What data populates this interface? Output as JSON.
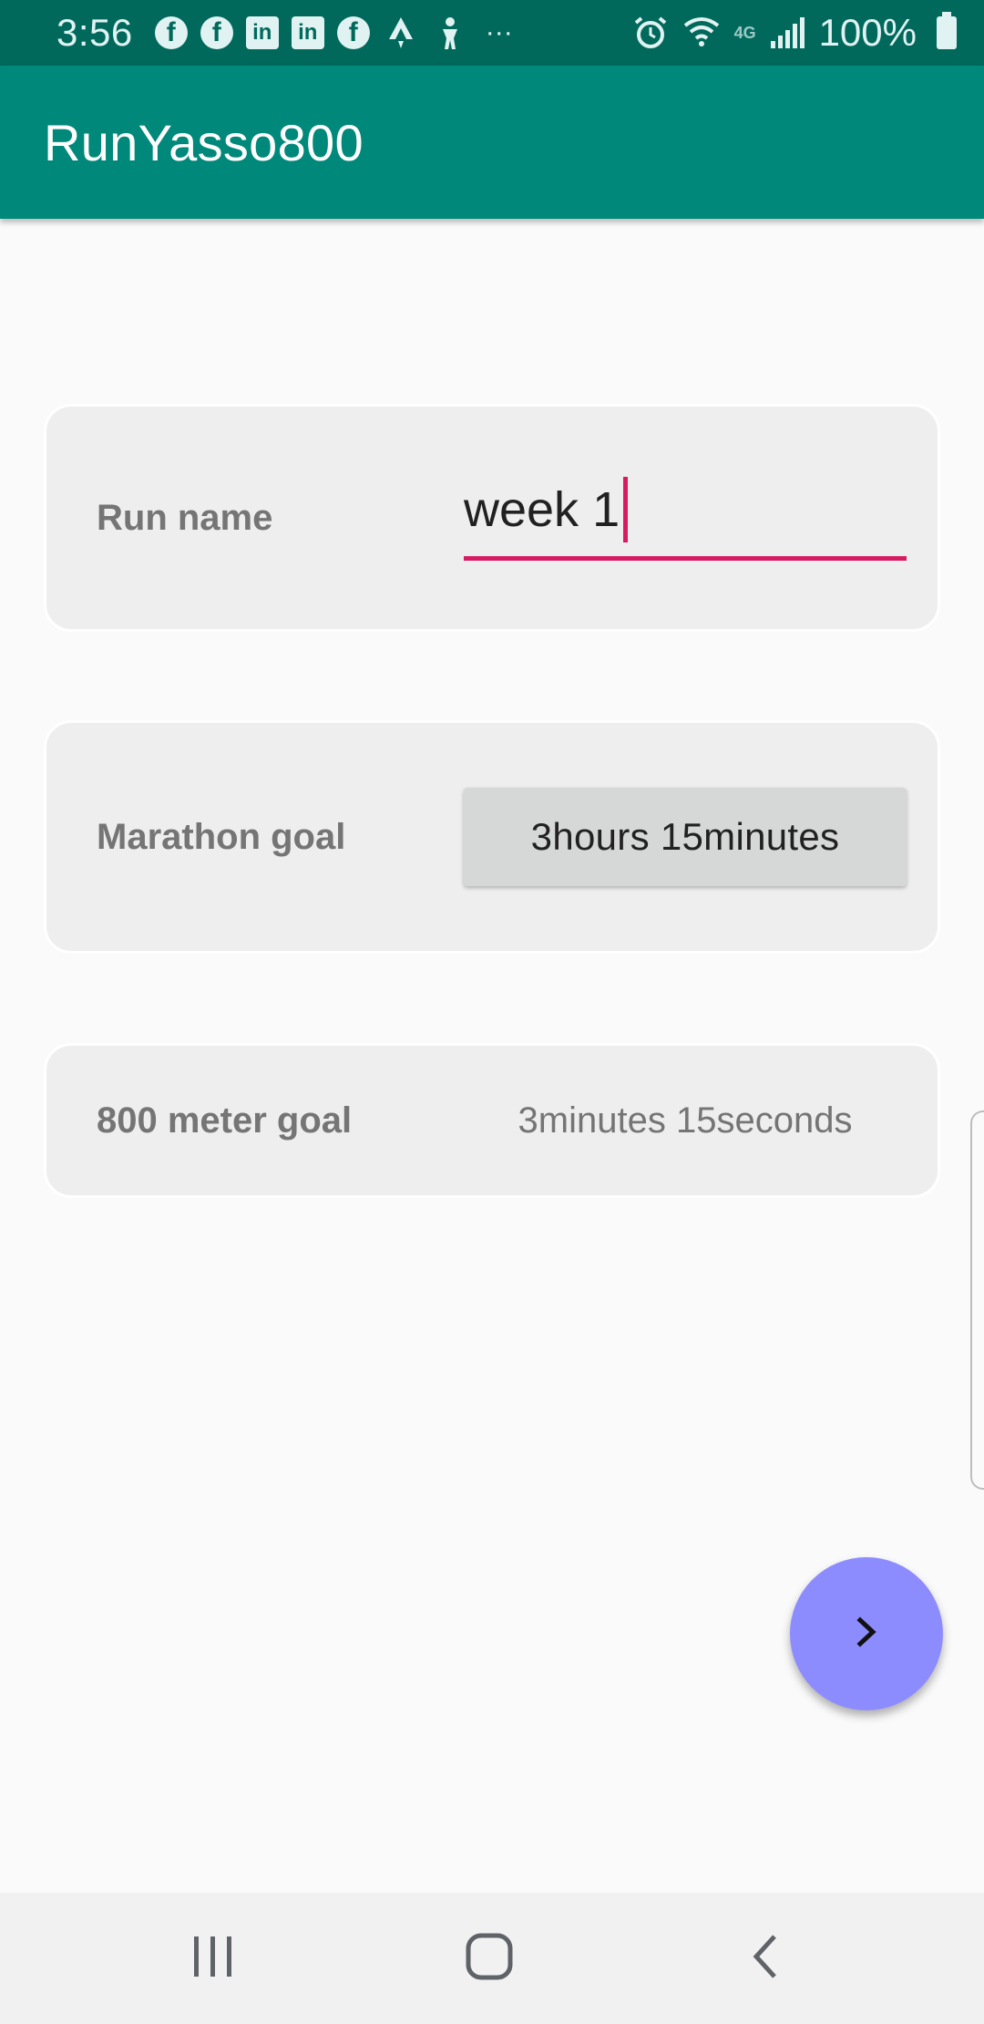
{
  "status_bar": {
    "time": "3:56",
    "notification_icons": [
      "facebook-icon",
      "facebook-icon",
      "linkedin-icon",
      "linkedin-icon",
      "facebook-icon",
      "strava-icon",
      "person-icon",
      "more-dots-icon"
    ],
    "more_dots": "···",
    "network_type": "4G",
    "battery_percent": "100%"
  },
  "app_bar": {
    "title": "RunYasso800",
    "color": "#00897b"
  },
  "form": {
    "run_name": {
      "label": "Run name",
      "value": "week 1"
    },
    "marathon_goal": {
      "label": "Marathon goal",
      "button_label": "3hours 15minutes"
    },
    "meter_goal": {
      "label": "800 meter goal",
      "value": "3minutes 15seconds"
    }
  },
  "fab": {
    "icon": "chevron-right-icon",
    "color": "#8c8cff"
  },
  "nav_bar": {
    "buttons": [
      "recents-icon",
      "home-icon",
      "back-icon"
    ]
  },
  "accent_color": "#d81b60"
}
